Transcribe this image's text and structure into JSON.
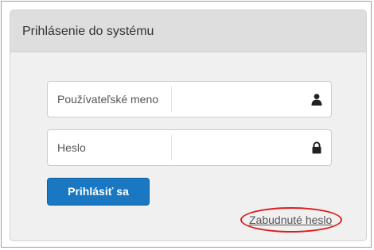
{
  "panel": {
    "title": "Prihlásenie do systému"
  },
  "username": {
    "label": "Používateľské meno",
    "value": "",
    "icon": "user-icon"
  },
  "password": {
    "label": "Heslo",
    "value": "",
    "icon": "lock-icon"
  },
  "login_button": {
    "label": "Prihlásiť sa"
  },
  "forgot_password": {
    "label": "Zabudnuté heslo"
  },
  "colors": {
    "primary_button": "#1a78c2",
    "highlight_annotation": "#e01b1b",
    "panel_background": "#f0f0f0",
    "header_background": "#dedede"
  }
}
